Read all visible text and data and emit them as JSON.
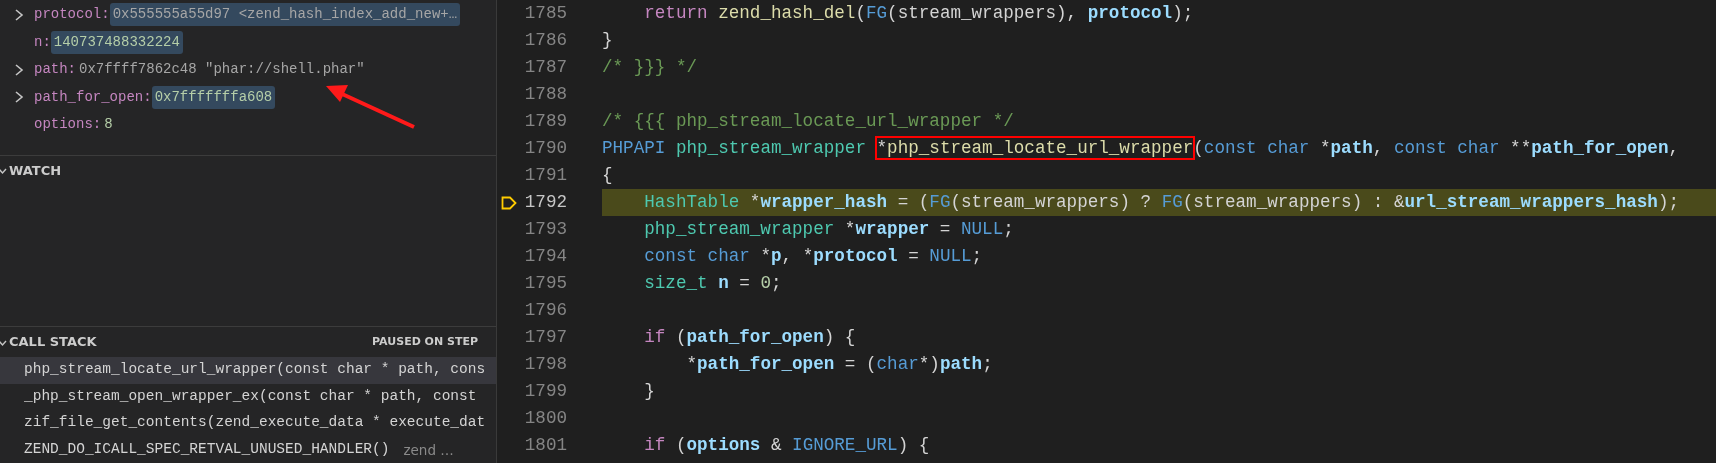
{
  "variables": [
    {
      "name": "protocol:",
      "value": "0x555555a55d97 <zend_hash_index_add_new+…",
      "kind": "text",
      "expandable": true,
      "changed": true
    },
    {
      "name": "n:",
      "value": "140737488332224",
      "kind": "number",
      "expandable": false,
      "changed": true
    },
    {
      "name": "path:",
      "value": "0x7ffff7862c48 \"phar://shell.phar\"",
      "kind": "text",
      "expandable": true,
      "changed": false
    },
    {
      "name": "path_for_open:",
      "value": "0x7fffffffa608",
      "kind": "number",
      "expandable": true,
      "changed": true
    },
    {
      "name": "options:",
      "value": "8",
      "kind": "number",
      "expandable": false,
      "changed": false
    }
  ],
  "watch": {
    "title": "WATCH",
    "expanded": true
  },
  "call_stack": {
    "title": "CALL STACK",
    "expanded": true,
    "badge": "PAUSED ON STEP",
    "frames": [
      {
        "label": "php_stream_locate_url_wrapper(const char * path, cons",
        "selected": true
      },
      {
        "label": "_php_stream_open_wrapper_ex(const char * path, const",
        "selected": false
      },
      {
        "label": "zif_file_get_contents(zend_execute_data * execute_dat",
        "selected": false
      },
      {
        "label": "ZEND_DO_ICALL_SPEC_RETVAL_UNUSED_HANDLER()",
        "source": "zend …",
        "selected": false
      }
    ]
  },
  "editor": {
    "lines": [
      {
        "number": "1785",
        "current": false,
        "tokens": [
          {
            "text": "    return",
            "kind": "keyword"
          },
          {
            "text": " zend_hash_del",
            "kind": "function"
          },
          {
            "text": "("
          },
          {
            "text": "FG",
            "kind": "macro"
          },
          {
            "text": "(stream_wrappers), "
          },
          {
            "text": "protocol",
            "kind": "variable"
          },
          {
            "text": ");"
          }
        ]
      },
      {
        "number": "1786",
        "current": false,
        "tokens": [
          {
            "text": "}"
          }
        ]
      },
      {
        "number": "1787",
        "current": false,
        "tokens": [
          {
            "text": "/* }}} */",
            "kind": "comment"
          }
        ]
      },
      {
        "number": "1788",
        "current": false
      },
      {
        "number": "1789",
        "current": false,
        "tokens": [
          {
            "text": "/* {{{ php_stream_locate_url_wrapper */",
            "kind": "comment"
          }
        ]
      },
      {
        "number": "1790",
        "current": false,
        "tokens": [
          {
            "text": "PHPAPI",
            "kind": "macro"
          },
          {
            "text": " php_stream_wrapper ",
            "kind": "type"
          },
          {
            "text": "*",
            "boxed": true
          },
          {
            "text": "php_stream_locate_url_wrapper",
            "kind": "function",
            "boxed": true
          },
          {
            "text": "("
          },
          {
            "text": "const",
            "kind": "macro"
          },
          {
            "text": " char",
            "kind": "macro"
          },
          {
            "text": " *"
          },
          {
            "text": "path",
            "kind": "variable"
          },
          {
            "text": ", "
          },
          {
            "text": "const",
            "kind": "macro"
          },
          {
            "text": " char",
            "kind": "macro"
          },
          {
            "text": " **"
          },
          {
            "text": "path_for_open",
            "kind": "variable"
          },
          {
            "text": ","
          }
        ]
      },
      {
        "number": "1791",
        "current": false,
        "tokens": [
          {
            "text": "{"
          }
        ]
      },
      {
        "number": "1792",
        "current": true,
        "tokens": [
          {
            "text": "    HashTable",
            "kind": "type"
          },
          {
            "text": " *"
          },
          {
            "text": "wrapper_hash",
            "kind": "variable"
          },
          {
            "text": " = ("
          },
          {
            "text": "FG",
            "kind": "macro"
          },
          {
            "text": "(stream_wrappers) ? "
          },
          {
            "text": "FG",
            "kind": "macro"
          },
          {
            "text": "(stream_wrappers) : &"
          },
          {
            "text": "url_stream_wrappers_hash",
            "kind": "variable"
          },
          {
            "text": ");"
          }
        ]
      },
      {
        "number": "1793",
        "current": false,
        "tokens": [
          {
            "text": "    php_stream_wrapper",
            "kind": "type"
          },
          {
            "text": " *"
          },
          {
            "text": "wrapper",
            "kind": "variable"
          },
          {
            "text": " = "
          },
          {
            "text": "NULL",
            "kind": "macro"
          },
          {
            "text": ";"
          }
        ]
      },
      {
        "number": "1794",
        "current": false,
        "tokens": [
          {
            "text": "    const",
            "kind": "macro"
          },
          {
            "text": " char",
            "kind": "macro"
          },
          {
            "text": " *"
          },
          {
            "text": "p",
            "kind": "variable"
          },
          {
            "text": ", *"
          },
          {
            "text": "protocol",
            "kind": "variable"
          },
          {
            "text": " = "
          },
          {
            "text": "NULL",
            "kind": "macro"
          },
          {
            "text": ";"
          }
        ]
      },
      {
        "number": "1795",
        "current": false,
        "tokens": [
          {
            "text": "    size_t",
            "kind": "type"
          },
          {
            "text": " n",
            "kind": "variable"
          },
          {
            "text": " = "
          },
          {
            "text": "0",
            "kind": "number"
          },
          {
            "text": ";"
          }
        ]
      },
      {
        "number": "1796",
        "current": false
      },
      {
        "number": "1797",
        "current": false,
        "tokens": [
          {
            "text": "    if",
            "kind": "keyword"
          },
          {
            "text": " ("
          },
          {
            "text": "path_for_open",
            "kind": "variable"
          },
          {
            "text": ") {"
          }
        ]
      },
      {
        "number": "1798",
        "current": false,
        "tokens": [
          {
            "text": "        *"
          },
          {
            "text": "path_for_open",
            "kind": "variable"
          },
          {
            "text": " = ("
          },
          {
            "text": "char",
            "kind": "macro"
          },
          {
            "text": "*)"
          },
          {
            "text": "path",
            "kind": "variable"
          },
          {
            "text": ";"
          }
        ]
      },
      {
        "number": "1799",
        "current": false,
        "tokens": [
          {
            "text": "    }"
          }
        ]
      },
      {
        "number": "1800",
        "current": false
      },
      {
        "number": "1801",
        "current": false,
        "tokens": [
          {
            "text": "    if",
            "kind": "keyword"
          },
          {
            "text": " ("
          },
          {
            "text": "options",
            "kind": "variable"
          },
          {
            "text": " & "
          },
          {
            "text": "IGNORE_URL",
            "kind": "macro"
          },
          {
            "text": ") {"
          }
        ]
      }
    ]
  }
}
